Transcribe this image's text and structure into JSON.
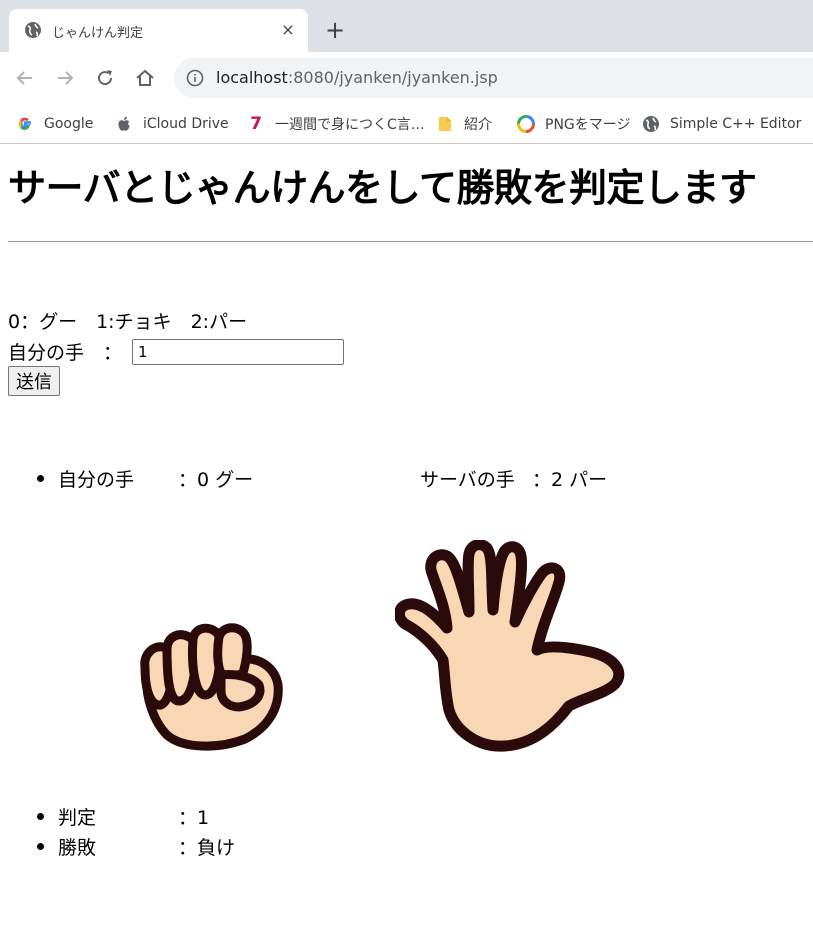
{
  "browser": {
    "tab_title": "じゃんけん判定",
    "tab_close": "×",
    "new_tab": "+",
    "url_host": "localhost",
    "url_rest": ":8080/jyanken/jyanken.jsp",
    "bookmarks": [
      {
        "label": "Google",
        "icon": "google-icon"
      },
      {
        "label": "iCloud Drive",
        "icon": "apple-icon"
      },
      {
        "label": "一週間で身につくC言…",
        "icon": "seven-icon"
      },
      {
        "label": "紹介",
        "icon": "folder-icon"
      },
      {
        "label": "PNGをマージ",
        "icon": "png-merge-icon"
      },
      {
        "label": "Simple C++ Editor",
        "icon": "globe-icon"
      }
    ],
    "seven_glyph": "7"
  },
  "page": {
    "title": "サーバとじゃんけんをして勝敗を判定します",
    "legend": "0：グー　1:チョキ　2:パー",
    "my_hand_label": "自分の手　：",
    "my_hand_value": "1",
    "submit_label": "送信",
    "result": {
      "my_hand_label": "自分の手",
      "my_hand_value": "：0 グー",
      "server_hand_label": "サーバの手",
      "server_hand_value": "：2 パー"
    },
    "judge": {
      "judge_label": "判定",
      "judge_value": "：1",
      "outcome_label": "勝敗",
      "outcome_value": "：負け"
    }
  },
  "colors": {
    "skin": "#f8d8b4",
    "outline": "#2a0a0a",
    "chrome_bg": "#dee1e6"
  }
}
